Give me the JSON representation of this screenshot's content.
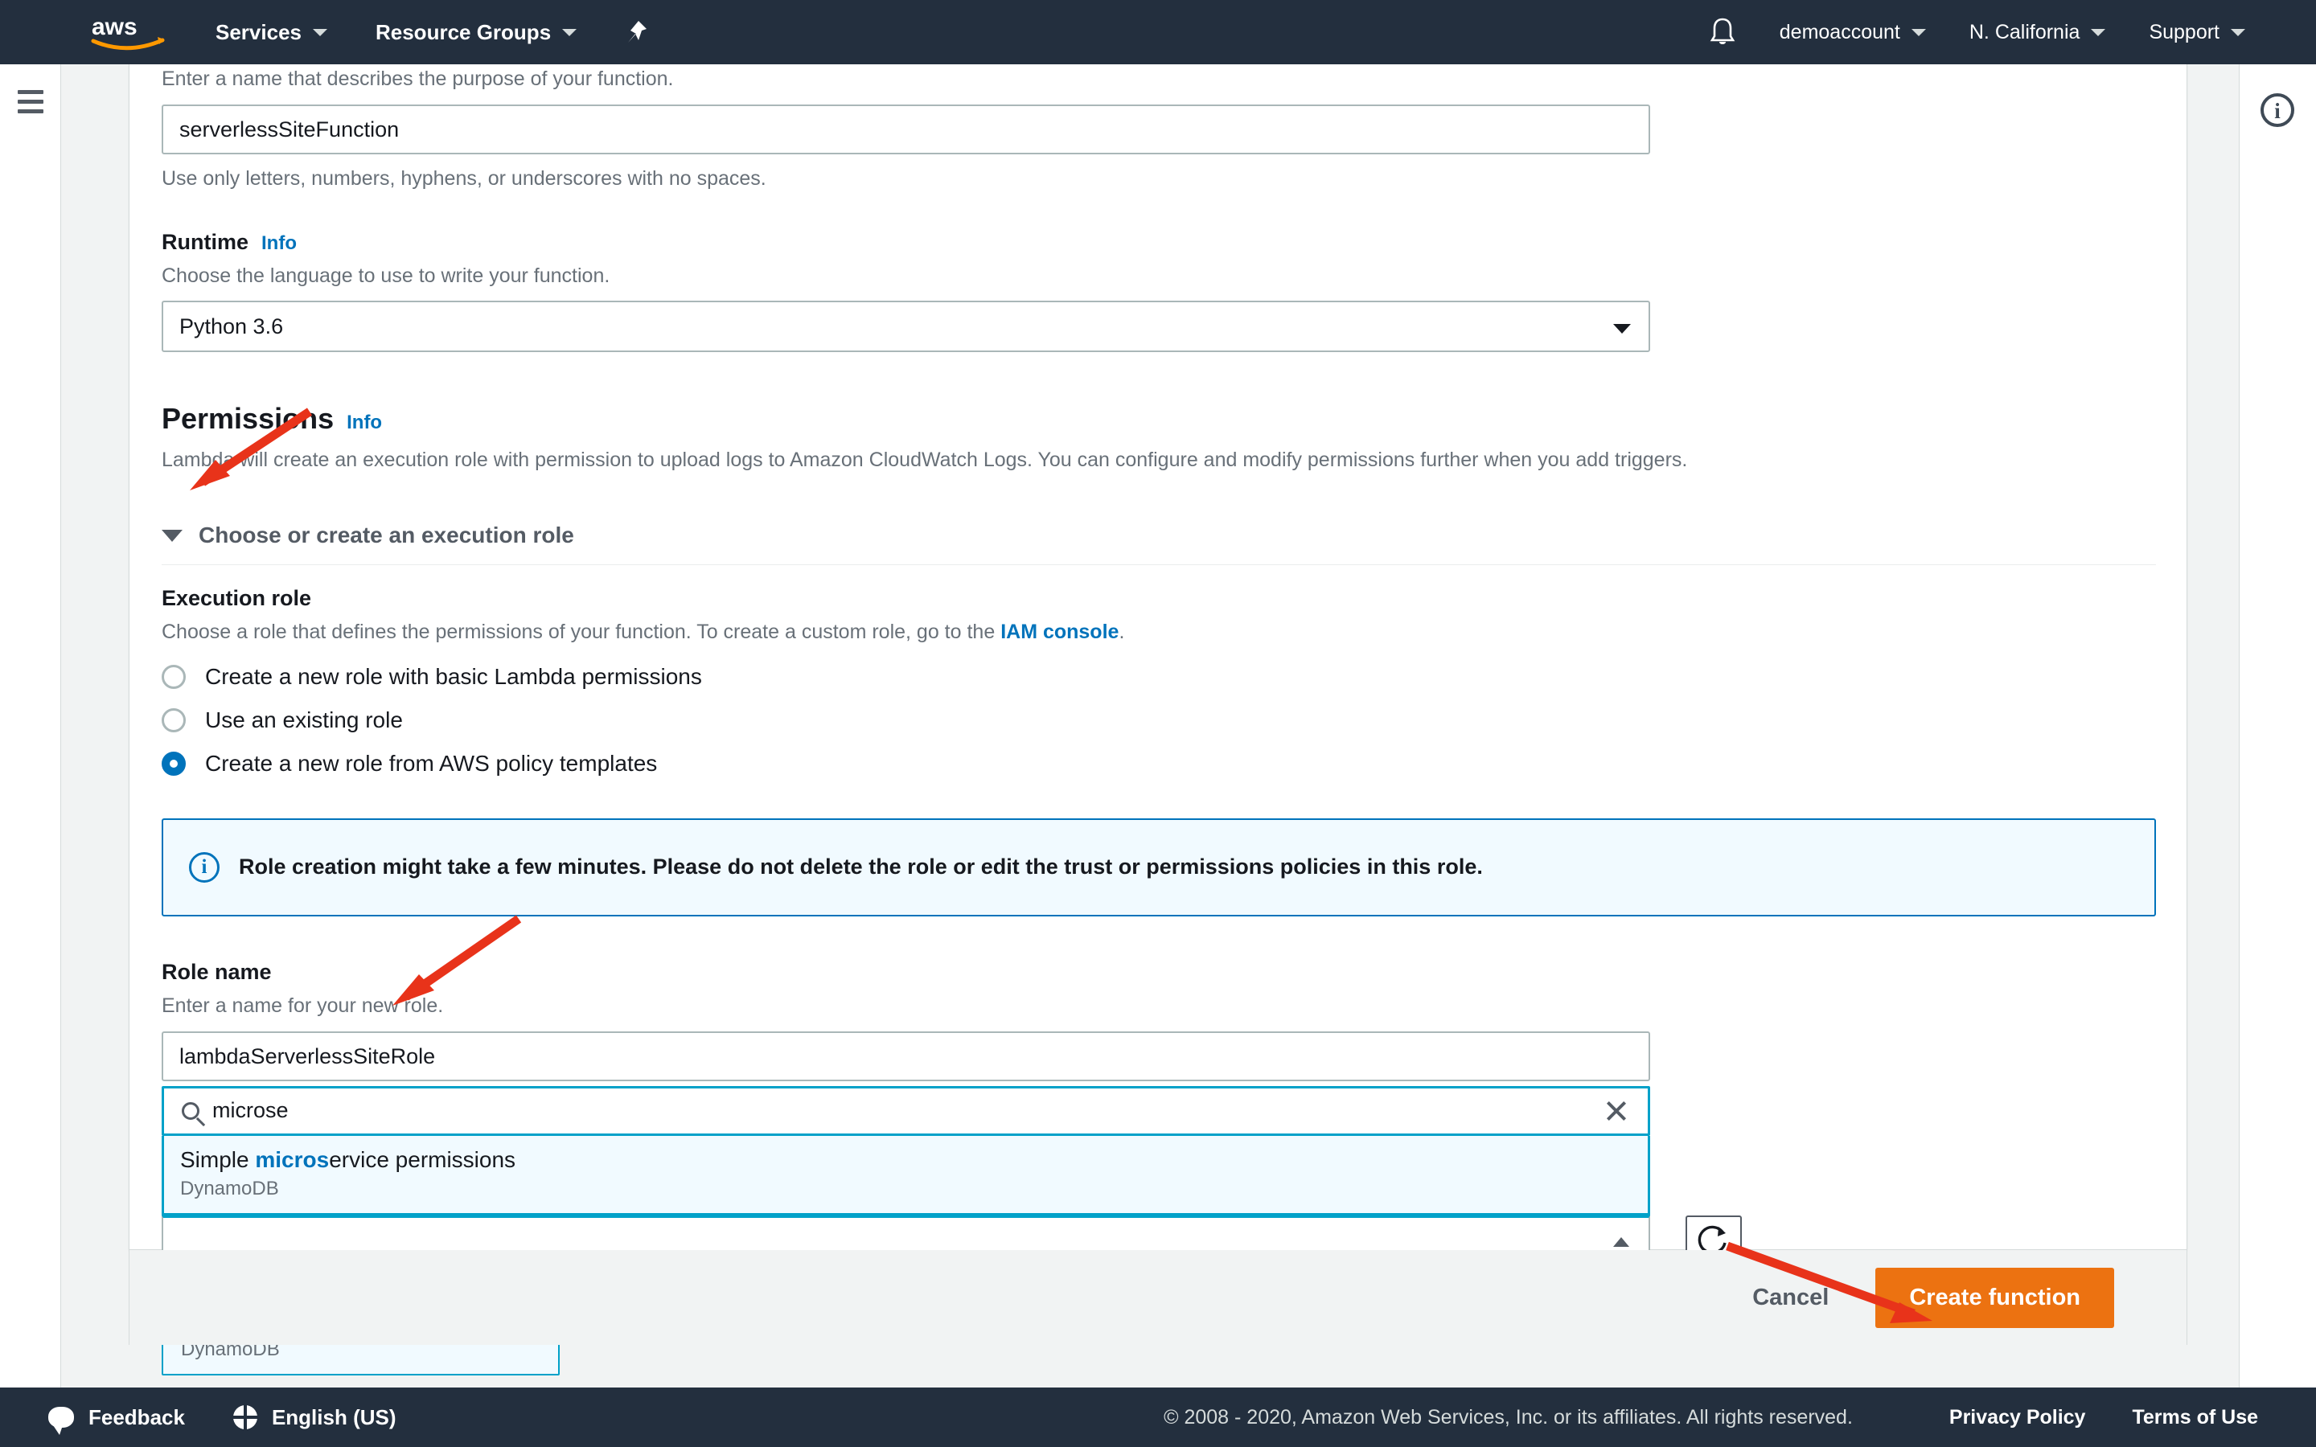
{
  "nav": {
    "logo_alt": "aws",
    "services": "Services",
    "resource_groups": "Resource Groups",
    "pin_icon": "pin-icon",
    "bell_icon": "bell-icon",
    "account": "demoaccount",
    "region": "N. California",
    "support": "Support"
  },
  "rails": {
    "menu_icon": "hamburger-menu-icon",
    "info_icon": "info-circle-icon",
    "info_glyph": "i"
  },
  "form": {
    "function_name": {
      "helper_top": "Enter a name that describes the purpose of your function.",
      "value": "serverlessSiteFunction",
      "helper_bottom": "Use only letters, numbers, hyphens, or underscores with no spaces."
    },
    "runtime": {
      "label": "Runtime",
      "info": "Info",
      "helper": "Choose the language to use to write your function.",
      "value": "Python 3.6"
    },
    "permissions": {
      "title": "Permissions",
      "info": "Info",
      "description": "Lambda will create an execution role with permission to upload logs to Amazon CloudWatch Logs. You can configure and modify permissions further when you add triggers.",
      "expander_label": "Choose or create an execution role",
      "expander_state": "expanded"
    },
    "execution_role": {
      "label": "Execution role",
      "helper_prefix": "Choose a role that defines the permissions of your function. To create a custom role, go to the ",
      "helper_link": "IAM console",
      "helper_suffix": ".",
      "options": [
        {
          "label": "Create a new role with basic Lambda permissions",
          "selected": false
        },
        {
          "label": "Use an existing role",
          "selected": false
        },
        {
          "label": "Create a new role from AWS policy templates",
          "selected": true
        }
      ]
    },
    "alert": {
      "icon": "info-icon",
      "text": "Role creation might take a few minutes. Please do not delete the role or edit the trust or permissions policies in this role."
    },
    "role_name": {
      "label": "Role name",
      "helper": "Enter a name for your new role.",
      "value": "lambdaServerlessSiteRole"
    },
    "policy_templates": {
      "search_icon": "search-icon",
      "search_value": "microse",
      "clear_icon": "clear-icon",
      "suggestion": {
        "prefix": "Simple ",
        "match": "micros",
        "suffix": "ervice permissions",
        "subtitle": "DynamoDB"
      },
      "collapse_icon": "chevron-up-icon",
      "refresh_icon": "refresh-icon",
      "selected_chip": {
        "title": "Simple microservice permissions",
        "subtitle": "DynamoDB",
        "remove_icon": "close-icon"
      }
    }
  },
  "actions": {
    "cancel": "Cancel",
    "create": "Create function"
  },
  "footer": {
    "feedback_icon": "feedback-bubble-icon",
    "feedback": "Feedback",
    "language_icon": "globe-icon",
    "language": "English (US)",
    "copyright": "© 2008 - 2020, Amazon Web Services, Inc. or its affiliates. All rights reserved.",
    "privacy": "Privacy Policy",
    "terms": "Terms of Use"
  },
  "annotations": {
    "accent_color": "#ec7211",
    "arrow_color": "#e8331a",
    "focus_color": "#00a1c9",
    "link_color": "#0073bb",
    "nav_bg": "#232f3e"
  }
}
